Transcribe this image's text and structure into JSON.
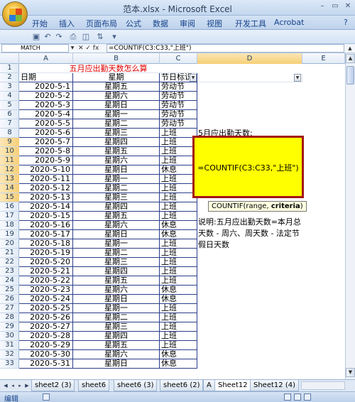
{
  "window": {
    "title": "范本.xlsx - Microsoft Excel",
    "controls": [
      "–",
      "▭",
      "✕"
    ]
  },
  "ribbon": {
    "tabs": [
      "开始",
      "插入",
      "页面布局",
      "公式",
      "数据",
      "审阅",
      "视图",
      "开发工具",
      "Acrobat"
    ],
    "help": "?"
  },
  "formula_bar": {
    "name_box": "MATCH",
    "icons": "✕ ✓ fx",
    "formula": "=COUNTIF(C3:C33,\"上班\")"
  },
  "columns": [
    "A",
    "B",
    "C",
    "D",
    "E"
  ],
  "title_row": "五月应出勤天数怎么算",
  "headers": {
    "date": "日期",
    "weekday": "星期",
    "holiday": "节日标识"
  },
  "rows": [
    [
      "2020-5-1",
      "星期五",
      "劳动节"
    ],
    [
      "2020-5-2",
      "星期六",
      "劳动节"
    ],
    [
      "2020-5-3",
      "星期日",
      "劳动节"
    ],
    [
      "2020-5-4",
      "星期一",
      "劳动节"
    ],
    [
      "2020-5-5",
      "星期二",
      "劳动节"
    ],
    [
      "2020-5-6",
      "星期三",
      "上班"
    ],
    [
      "2020-5-7",
      "星期四",
      "上班"
    ],
    [
      "2020-5-8",
      "星期五",
      "上班"
    ],
    [
      "2020-5-9",
      "星期六",
      "上班"
    ],
    [
      "2020-5-10",
      "星期日",
      "休息"
    ],
    [
      "2020-5-11",
      "星期一",
      "上班"
    ],
    [
      "2020-5-12",
      "星期二",
      "上班"
    ],
    [
      "2020-5-13",
      "星期三",
      "上班"
    ],
    [
      "2020-5-14",
      "星期四",
      "上班"
    ],
    [
      "2020-5-15",
      "星期五",
      "上班"
    ],
    [
      "2020-5-16",
      "星期六",
      "休息"
    ],
    [
      "2020-5-17",
      "星期日",
      "休息"
    ],
    [
      "2020-5-18",
      "星期一",
      "上班"
    ],
    [
      "2020-5-19",
      "星期二",
      "上班"
    ],
    [
      "2020-5-20",
      "星期三",
      "上班"
    ],
    [
      "2020-5-21",
      "星期四",
      "上班"
    ],
    [
      "2020-5-22",
      "星期五",
      "上班"
    ],
    [
      "2020-5-23",
      "星期六",
      "休息"
    ],
    [
      "2020-5-24",
      "星期日",
      "休息"
    ],
    [
      "2020-5-25",
      "星期一",
      "上班"
    ],
    [
      "2020-5-26",
      "星期二",
      "上班"
    ],
    [
      "2020-5-27",
      "星期三",
      "上班"
    ],
    [
      "2020-5-28",
      "星期四",
      "上班"
    ],
    [
      "2020-5-29",
      "星期五",
      "上班"
    ],
    [
      "2020-5-30",
      "星期六",
      "休息"
    ],
    [
      "2020-5-31",
      "星期日",
      "休息"
    ]
  ],
  "side": {
    "label": "5月应出勤天数:",
    "edit_formula": "=COUNTIF(C3:C33,\"上班\")",
    "tooltip_fn": "COUNTIF(range, ",
    "tooltip_bold": "criteria",
    "tooltip_end": ")",
    "note": "说明:五月应出勤天数=本月总天数 - 周六、周天数 - 法定节假日天数"
  },
  "sheet_tabs": [
    "sheet2 (3)",
    "sheet6",
    "sheet6 (3)",
    "sheet6 (2)",
    "A",
    "Sheet12",
    "Sheet12 (4)"
  ],
  "active_tab_index": 5,
  "status": "编辑",
  "colors": {
    "accent_red": "#e00000",
    "highlight_yellow": "#ffff00",
    "box_border": "#a31515"
  }
}
